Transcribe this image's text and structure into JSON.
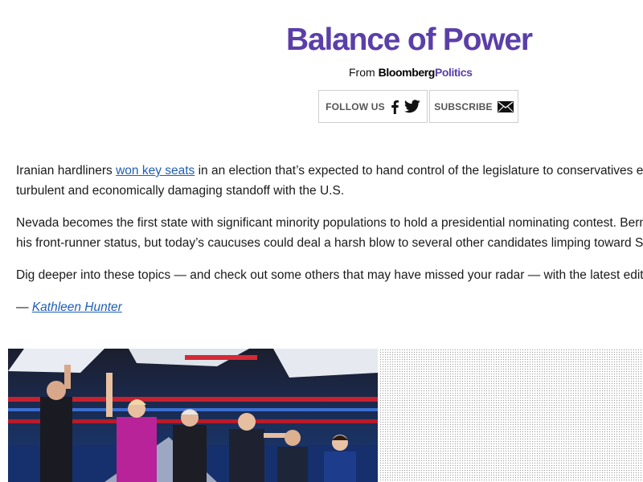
{
  "header": {
    "title": "Balance of Power",
    "from_label": "From",
    "brand_bold": "Bloomberg",
    "brand_accent": "Politics",
    "follow_label": "FOLLOW US",
    "subscribe_label": "SUBSCRIBE"
  },
  "content": {
    "p1_before": "Iranian hardliners ",
    "p1_link": "won key seats",
    "p1_after": " in an election that’s expected to hand control of the legislature to conservatives er",
    "p1_line2": "turbulent and economically damaging standoff with the U.S.",
    "p2_line1": "Nevada becomes the first state with significant minority populations to hold a presidential nominating contest. Bern",
    "p2_line2": "his front-runner status, but today’s caucuses could deal a harsh blow to several other candidates limping toward Su",
    "p3": "Dig deeper into these topics — and check out some others that may have missed your radar — with the latest edit",
    "signoff_dash": "— ",
    "signoff_author": "Kathleen Hunter"
  },
  "colors": {
    "accent": "#5b3fa8",
    "link": "#1f5fb5"
  },
  "icons": [
    "facebook-icon",
    "twitter-icon",
    "envelope-icon"
  ]
}
